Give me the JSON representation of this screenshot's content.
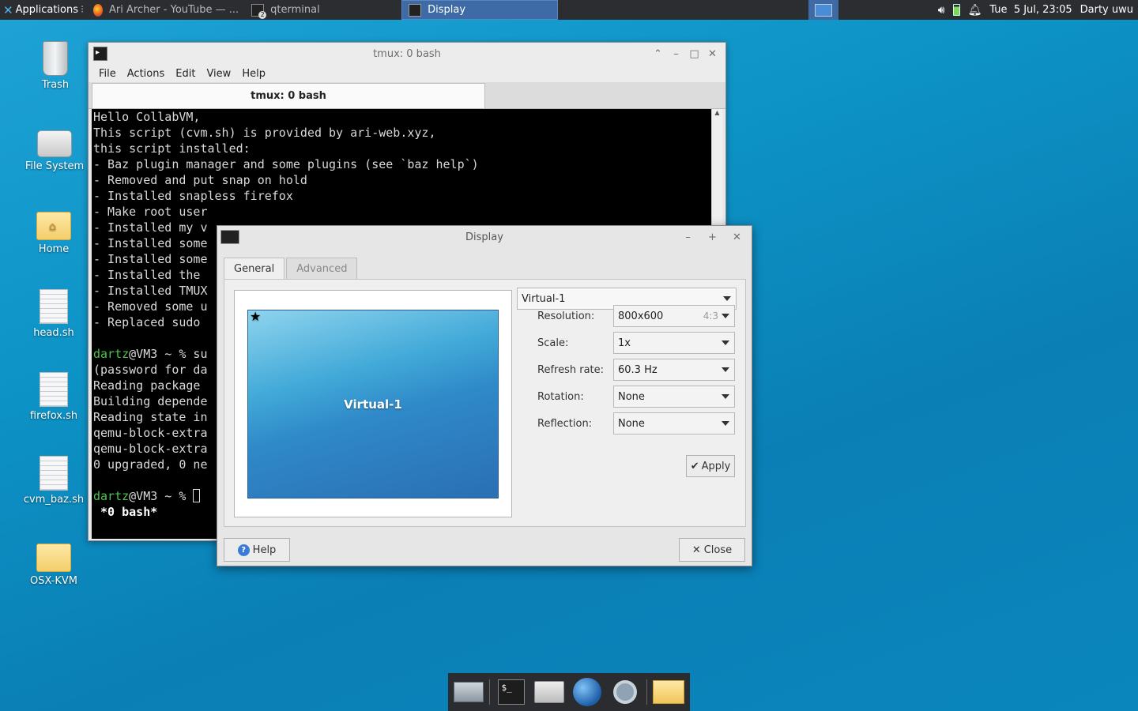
{
  "top_panel": {
    "apps_label": "Applications",
    "tasks": [
      {
        "label": "Ari Archer - YouTube — ...",
        "icon": "firefox-icon"
      },
      {
        "label": "qterminal",
        "icon": "terminal-icon",
        "badge": "2"
      },
      {
        "label": "Display",
        "icon": "display-icon"
      }
    ],
    "clock": "Tue  5 Jul, 23:05",
    "user": "Darty uwu"
  },
  "desktop_icons": [
    {
      "label": "Trash",
      "icon": "trash-icon"
    },
    {
      "label": "File System",
      "icon": "drive-icon"
    },
    {
      "label": "Home",
      "icon": "home-folder-icon"
    },
    {
      "label": "head.sh",
      "icon": "script-file-icon"
    },
    {
      "label": "firefox.sh",
      "icon": "script-file-icon"
    },
    {
      "label": "cvm_baz.sh",
      "icon": "script-file-icon"
    },
    {
      "label": "OSX-KVM",
      "icon": "folder-icon"
    }
  ],
  "terminal": {
    "title": "tmux: 0 bash",
    "menu": [
      "File",
      "Actions",
      "Edit",
      "View",
      "Help"
    ],
    "tab_label": "tmux: 0 bash",
    "lines": [
      "Hello CollabVM,",
      "This script (cvm.sh) is provided by ari-web.xyz,",
      "this script installed:",
      "",
      "- Baz plugin manager and some plugins (see `baz help`)",
      "- Removed and put snap on hold",
      "- Installed snapless firefox",
      "- Make root user",
      "- Installed my v",
      "- Installed some",
      "- Installed some",
      "- Installed the",
      "- Installed TMUX",
      "- Removed some u",
      "- Replaced sudo"
    ],
    "prompt_user": "dartz",
    "prompt_rest_1": "@VM3 ~ % su",
    "output_lines": [
      "(password for da",
      "Reading package",
      "Building depende",
      "Reading state in",
      "qemu-block-extra",
      "qemu-block-extra",
      "0 upgraded, 0 ne"
    ],
    "prompt_rest_2": "@VM3 ~ % ",
    "status_line": " *0 bash*"
  },
  "display_dialog": {
    "title": "Display",
    "tabs": [
      {
        "label": "General",
        "active": true
      },
      {
        "label": "Advanced",
        "active": false
      }
    ],
    "preview_label": "Virtual-1",
    "output_select": "Virtual-1",
    "fields": [
      {
        "label": "Resolution:",
        "value": "800x600",
        "hint": "4:3"
      },
      {
        "label": "Scale:",
        "value": "1x"
      },
      {
        "label": "Refresh rate:",
        "value": "60.3 Hz"
      },
      {
        "label": "Rotation:",
        "value": "None"
      },
      {
        "label": "Reflection:",
        "value": "None"
      }
    ],
    "apply_label": "Apply",
    "help_label": "Help",
    "close_label": "Close"
  },
  "dock": [
    "show-desktop-icon",
    "terminal-icon",
    "home-icon",
    "web-browser-icon",
    "search-icon",
    "folder-icon"
  ]
}
